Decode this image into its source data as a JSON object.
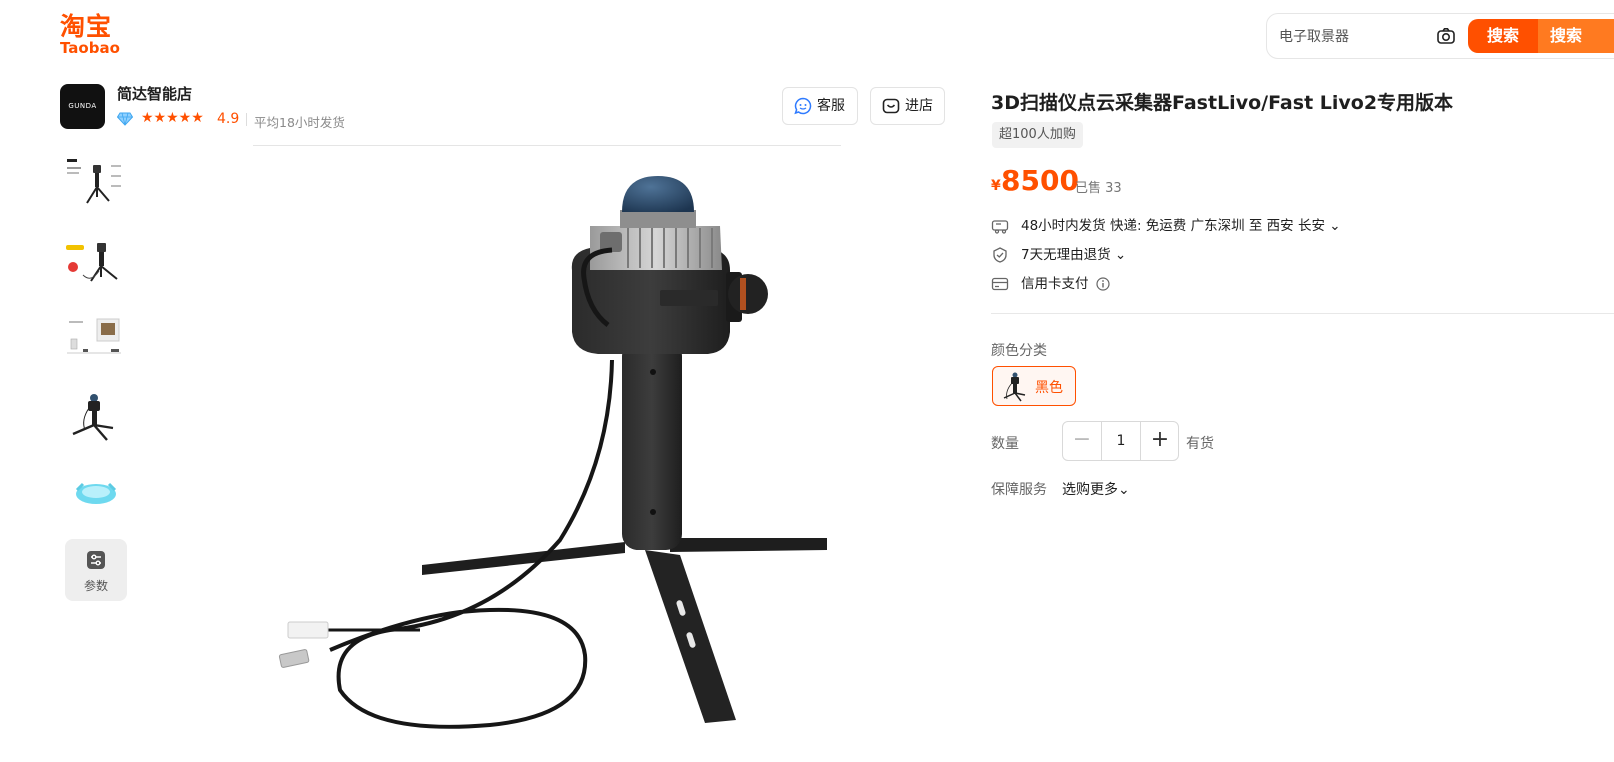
{
  "logo": {
    "cn": "淘宝",
    "en": "Taobao"
  },
  "search": {
    "placeholder": "电子取景器",
    "button": "搜索",
    "button2": "搜索"
  },
  "shop": {
    "avatar_text": "GUNDA",
    "name": "简达智能店",
    "stars": "★★★★★",
    "rating": "4.9",
    "avg_ship": "平均18小时发货",
    "service_btn": "客服",
    "enter_btn": "进店"
  },
  "thumbnails": {
    "param_label": "参数"
  },
  "product": {
    "title": "3D扫描仪点云采集器FastLivo/Fast Livo2专用版本",
    "tag": "超100人加购",
    "currency": "¥",
    "price": "8500",
    "sold": "已售 33",
    "shipping": "48小时内发货   快递: 免运费   广东深圳 至 西安 长安 ⌄",
    "returns": "7天无理由退货 ⌄",
    "payment": "信用卡支付"
  },
  "options": {
    "color_label": "颜色分类",
    "color_value": "黑色",
    "qty_label": "数量",
    "qty_minus": "−",
    "qty_value": "1",
    "qty_plus": "+",
    "stock": "有货",
    "service_label": "保障服务",
    "service_value": "选购更多⌄"
  },
  "colors": {
    "brand": "#ff5000",
    "brand_light": "#ff7a20"
  }
}
